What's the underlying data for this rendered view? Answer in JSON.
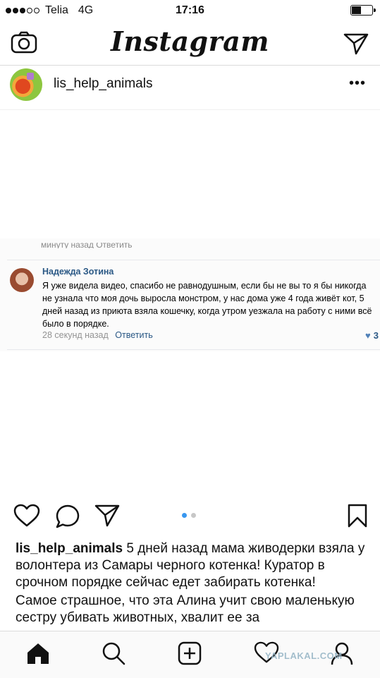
{
  "status_bar": {
    "carrier": "Telia",
    "network": "4G",
    "time": "17:16"
  },
  "app": {
    "title": "Instagram"
  },
  "post": {
    "username": "lis_help_animals",
    "more_label": "•••",
    "comment": {
      "clipped_text": "минуту назад  Ответить",
      "author": "Надежда Зотина",
      "text": "Я уже видела видео, спасибо не равнодушным, если бы не вы то я бы никогда не узнала что моя дочь выросла монстром, у нас дома уже 4 года живёт кот, 5 дней назад из приюта взяла кошечку, когда утром уезжала на работу с ними всё было в порядке.",
      "time": "28 секунд назад",
      "reply_label": "Ответить",
      "likes": "3"
    },
    "carousel": {
      "count": 2,
      "active": 1
    },
    "caption_user": "lis_help_animals",
    "caption_text": "5 дней назад мама живодерки взяла у волонтера из Самары черного котенка! Куратор в срочном порядке сейчас едет забирать котенка!",
    "caption_text2": "Самое страшное, что эта Алина учит свою маленькую сестру убивать животных, хвалит ее за"
  },
  "watermark": "YAPLAKAL.COM",
  "colors": {
    "accent": "#3897f0",
    "vk_link": "#2a5885"
  }
}
